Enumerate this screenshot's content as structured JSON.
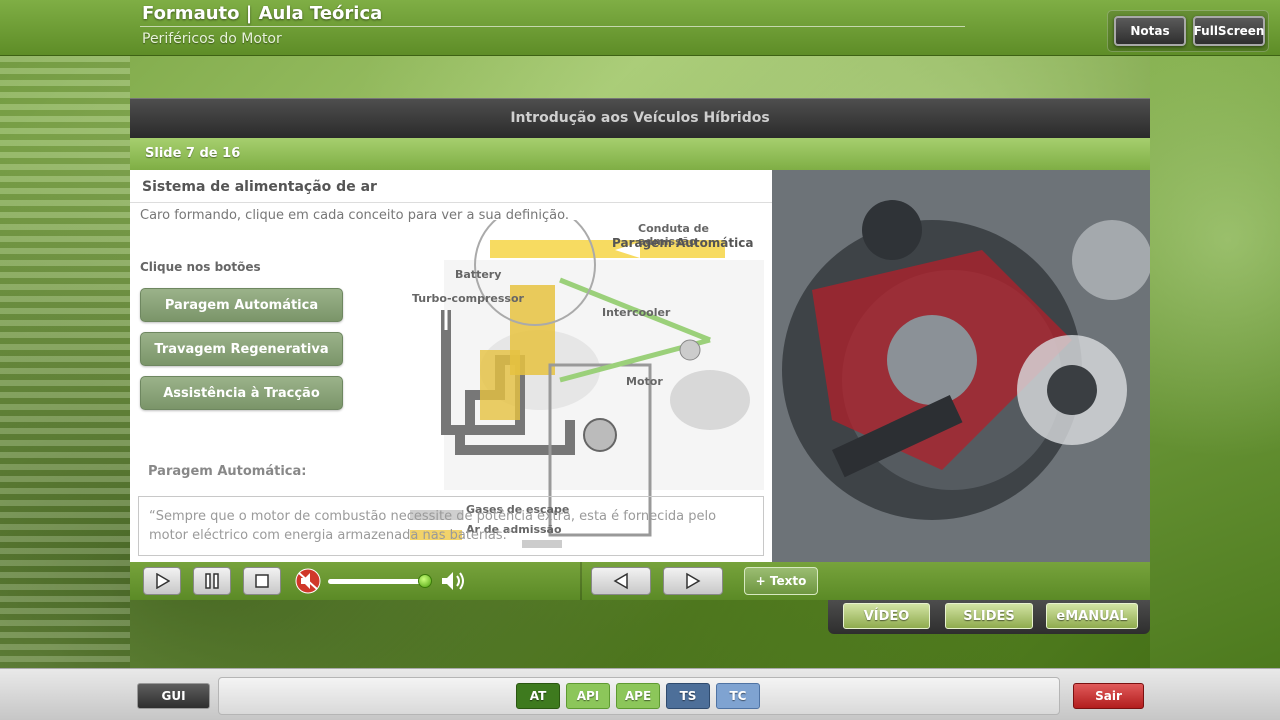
{
  "header": {
    "title": "Formauto | Aula Teórica",
    "subtitle": "Periféricos do Motor",
    "notes_label": "Notas",
    "fullscreen_label": "FullScreen"
  },
  "slide": {
    "title": "Introdução aos Veículos Híbridos",
    "counter": "Slide 7 de 16"
  },
  "content": {
    "heading": "Sistema de alimentação de ar",
    "intro": "Caro formando, clique em cada conceito para ver a sua definição.",
    "click_label": "Clique nos botões",
    "buttons": [
      "Paragem Automática",
      "Travagem Regenerativa",
      "Assistência à Tracção"
    ],
    "definition_title": "Paragem Automática:",
    "definition_text": "“Sempre que o motor de combustão necessite de potência extra, esta é fornecida pelo motor eléctrico com energia armazenada nas baterias.”"
  },
  "diagram": {
    "labels": {
      "conduta": "Conduta de admissão",
      "paragem": "Paragem Automática",
      "battery": "Battery",
      "turbo": "Turbo-compressor",
      "intercooler": "Intercooler",
      "motor": "Motor",
      "gases": "Gases de escape",
      "ar": "Ar de admissão"
    }
  },
  "player": {
    "texto_label": "+ Texto",
    "volume": 0.95
  },
  "media_tabs": [
    "VÍDEO",
    "SLIDES",
    "eMANUAL"
  ],
  "footer": {
    "gui_label": "GUI",
    "tabs": [
      "AT",
      "API",
      "APE",
      "TS",
      "TC"
    ],
    "sair_label": "Sair"
  },
  "colors": {
    "accent_green": "#7fae45",
    "tab_dark_green": "#3e7a1e",
    "tab_light_green": "#8cc65a",
    "tab_blue": "#4d6f99",
    "tab_light_blue": "#7fa3d1",
    "exit_red": "#c22a2a"
  }
}
